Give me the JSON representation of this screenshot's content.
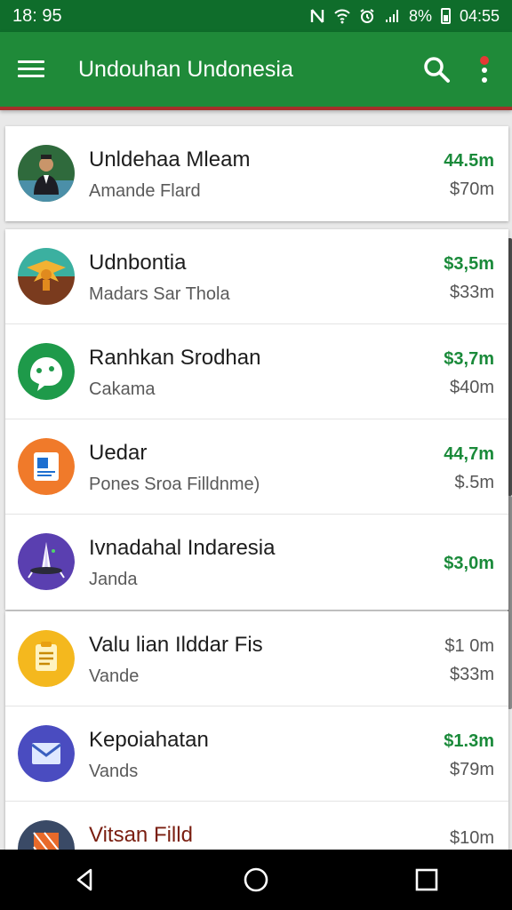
{
  "status_bar": {
    "time": "18: 95",
    "battery_pct": "8%",
    "clock": "04:55"
  },
  "app_bar": {
    "title": "Undouhan Undonesia",
    "menu_icon": "hamburger-menu-icon",
    "search_icon": "search-icon",
    "overflow_icon": "overflow-menu-icon"
  },
  "colors": {
    "status_bar": "#0f6d2b",
    "app_bar": "#1f8a39",
    "accent_green": "#1a8a3a"
  },
  "items": [
    {
      "name": "Unldehaa Mleam",
      "subtitle": "Amande Flard",
      "amount_primary": "44.5m",
      "amount_secondary": "$70m",
      "icon": "person-photo-icon"
    },
    {
      "name": "Udnbontia",
      "subtitle": "Madars Sar Thola",
      "amount_primary": "$3,5m",
      "amount_secondary": "$33m",
      "icon": "garuda-emblem-icon"
    },
    {
      "name": "Ranhkan Srodhan",
      "subtitle": "Cakama",
      "amount_primary": "$3,7m",
      "amount_secondary": "$40m",
      "icon": "ghost-chat-icon"
    },
    {
      "name": "Uedar",
      "subtitle": "Pones  Sroa Filldnme)",
      "amount_primary": "44,7m",
      "amount_secondary": "$.5m",
      "icon": "document-icon"
    },
    {
      "name": "Ivnadahal  Indaresia",
      "subtitle": "Janda",
      "amount_primary": "$3,0m",
      "amount_secondary": "",
      "icon": "rocket-monument-icon"
    },
    {
      "name": "Valu lian Ilddar Fis",
      "subtitle": "Vande",
      "amount_primary": "$1 0m",
      "amount_secondary": "$33m",
      "icon": "notes-icon"
    },
    {
      "name": "Kepoiahatan",
      "subtitle": "Vands",
      "amount_primary": "$1.3m",
      "amount_secondary": "$79m",
      "icon": "mail-icon"
    },
    {
      "name": "Vitsan Filld",
      "subtitle": "",
      "amount_primary": "$10m",
      "amount_secondary": "",
      "icon": "pattern-icon"
    }
  ],
  "nav": {
    "back": "back-icon",
    "home": "home-icon",
    "recents": "recents-icon"
  }
}
